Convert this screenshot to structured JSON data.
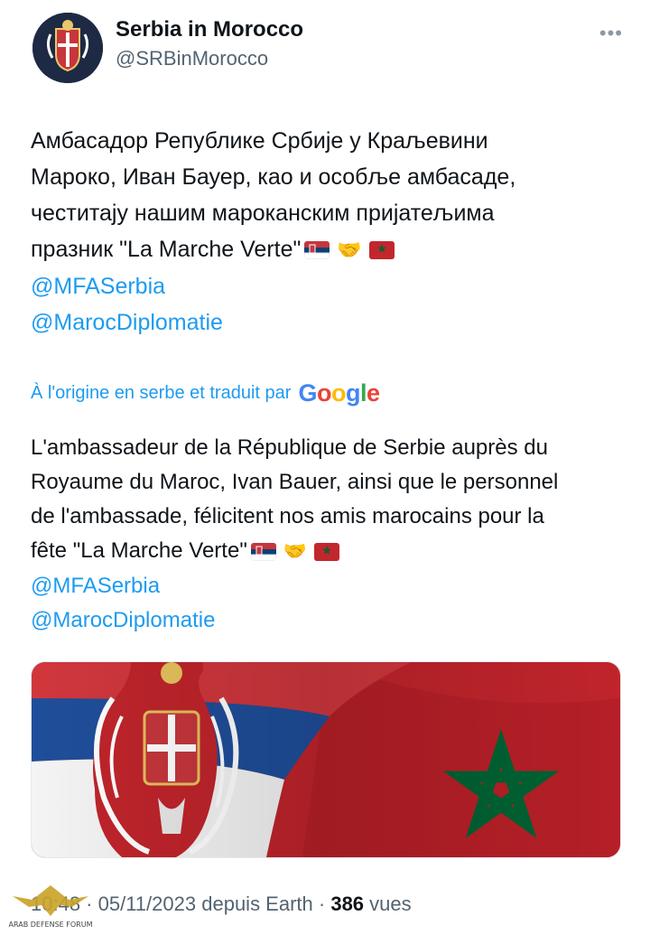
{
  "author": {
    "display_name": "Serbia in Morocco",
    "handle": "@SRBinMorocco"
  },
  "more_icon": "more-horizontal-icon",
  "original": {
    "lines": [
      "Амбасадор Републике Србије у Краљевини",
      "Мароко, Иван Бауер, као и особље амбасаде,",
      "честитају нашим мароканским пријатељима",
      "празник \"La Marche Verte\""
    ],
    "mentions": [
      "@MFASerbia",
      "@MarocDiplomatie"
    ]
  },
  "translation_notice": {
    "text": "À l'origine en serbe et traduit par",
    "provider": "Google"
  },
  "translated": {
    "lines": [
      "L'ambassadeur de la République de Serbie auprès du",
      "Royaume du Maroc, Ivan Bauer, ainsi que le personnel",
      "de l'ambassade, félicitent nos amis marocains pour la",
      "fête \"La Marche Verte\""
    ],
    "mentions": [
      "@MFASerbia",
      "@MarocDiplomatie"
    ]
  },
  "emojis": [
    "serbia-flag",
    "handshake",
    "morocco-flag"
  ],
  "meta": {
    "time": "10:48",
    "date": "05/11/2023",
    "source": "depuis Earth",
    "views": "386",
    "views_label": "vues"
  },
  "watermark": {
    "text": "ARAB DEFENSE FORUM"
  },
  "colors": {
    "link": "#1d9bf0",
    "serbia_red": "#c6363c",
    "serbia_blue": "#0c4076",
    "morocco_red": "#c1272d",
    "morocco_green": "#006233"
  }
}
